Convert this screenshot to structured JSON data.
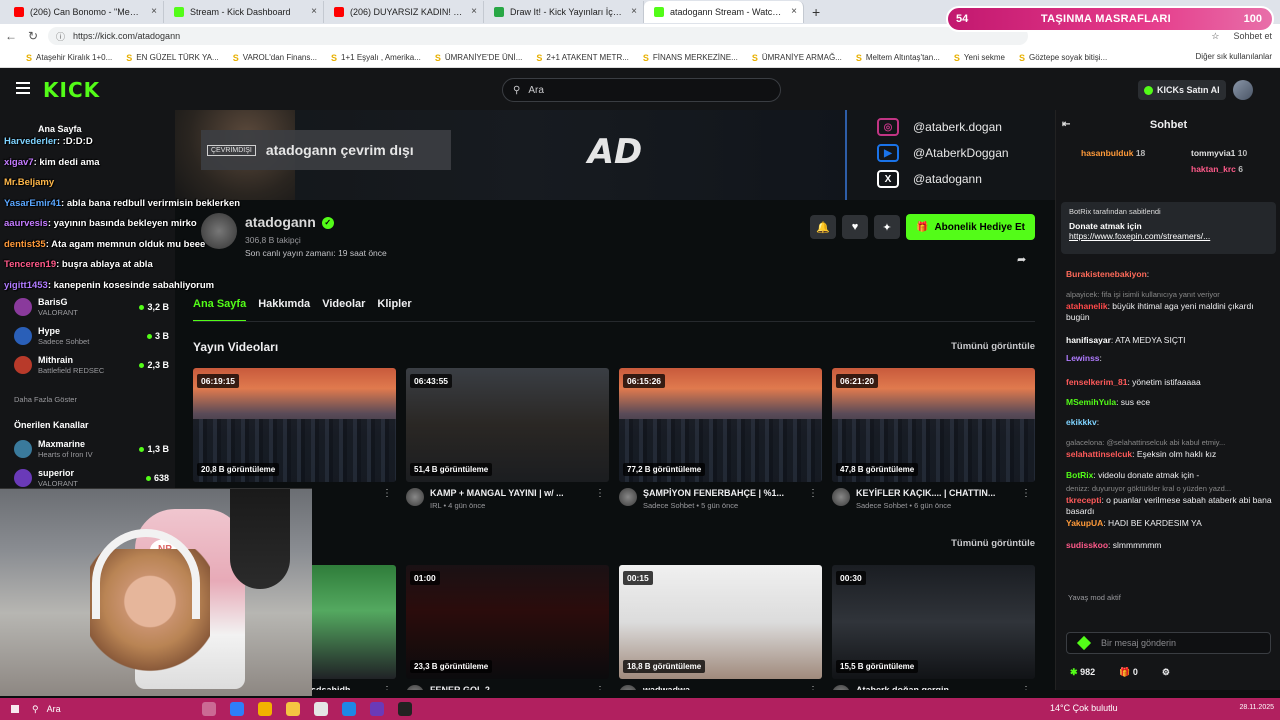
{
  "browser": {
    "tabs": [
      {
        "label": "(206) Can Bonomo - \"Mezcup\" - Y",
        "color": "#ff0000"
      },
      {
        "label": "Stream - Kick Dashboard",
        "color": "#53fc18"
      },
      {
        "label": "(206) DUYARSIZ KADIN! Türkiye'd",
        "color": "#ff0000"
      },
      {
        "label": "Draw It! - Kick Yayınları İçin Çizim",
        "color": "#28a745"
      },
      {
        "label": "atadogann Stream - Watch Live o",
        "color": "#53fc18"
      }
    ],
    "url": "https://kick.com/atadogann",
    "url_right": "Sohbet et",
    "bookmarks": [
      "Ataşehir Kiralık 1+0...",
      "EN GÜZEL TÜRK YA...",
      "VAROL'dan Finans...",
      "1+1 Eşyalı , Amerika...",
      "ÜMRANİYE'DE ÜNİ...",
      "2+1 ATAKENT METR...",
      "FİNANS MERKEZİNE...",
      "ÜMRANİYE ARMAĞ...",
      "Meltem Altıntaş'tan...",
      "Yeni sekme",
      "Göztepe soyak bitişi..."
    ],
    "bookmarks_right": "Diğer sık kullanılanlar"
  },
  "overlay_bar": {
    "left": "54",
    "title": "TAŞINMA MASRAFLARI",
    "right": "100"
  },
  "header": {
    "logo": "KICK",
    "search_placeholder": "Ara",
    "kicks_button": "KICKs Satın Al"
  },
  "sidebar": {
    "home": "Ana Sayfa",
    "channels": [
      {
        "name": "BarisG",
        "category": "VALORANT",
        "count": "3,2 B",
        "color": "#8a3a9c"
      },
      {
        "name": "Hype",
        "category": "Sadece Sohbet",
        "count": "3 B",
        "color": "#2a5fb8"
      },
      {
        "name": "Mithrain",
        "category": "Battlefield REDSEC",
        "count": "2,3 B",
        "color": "#b83a2a"
      }
    ],
    "show_more": "Daha Fazla Göster",
    "recommended_title": "Önerilen Kanallar",
    "recommended": [
      {
        "name": "Maxmarine",
        "category": "Hearts of Iron IV",
        "count": "1,3 B",
        "color": "#3a7a9c"
      },
      {
        "name": "superior",
        "category": "VALORANT",
        "count": "638",
        "color": "#6a3ab8"
      }
    ]
  },
  "overlay_chat": [
    {
      "user": "Harvederler",
      "text": ": :D:D:D",
      "color": "#7fd3ff"
    },
    {
      "user": "xigav7",
      "text": ": kim dedi ama",
      "color": "#c47bff"
    },
    {
      "user": "Mr.Beljamy",
      "text": "",
      "color": "#ffb84a"
    },
    {
      "user": "YasarEmir41",
      "text": ": abla bana redbull verirmisin beklerken",
      "color": "#5aa7ff"
    },
    {
      "user": "aaurvesis",
      "text": ": yayının basında bekleyen mirko",
      "color": "#c47bff"
    },
    {
      "user": "dentist35",
      "text": ": Ata agam memnun olduk mu beee",
      "color": "#ff9a3a"
    },
    {
      "user": "Tenceren19",
      "text": ": buşra ablaya at abla",
      "color": "#ff5a8a"
    },
    {
      "user": "yigitt1453",
      "text": ": kanepenin kosesinde sabahliyorum",
      "color": "#b07bff"
    }
  ],
  "channel": {
    "offline_tag": "ÇEVRİMDIŞI",
    "offline_text": "atadogann çevrim dışı",
    "banner_logo": "AD",
    "name": "atadogann",
    "followers": "306,8 B takipçi",
    "last_stream": "Son canlı yayın zamanı: 19 saat önce",
    "subscribe_label": "Abonelik Hediye Et",
    "socials": [
      {
        "handle": "@ataberk.dogan",
        "icon": "instagram-icon",
        "color": "#c13584"
      },
      {
        "handle": "@AtaberkDoggan",
        "icon": "youtube-icon",
        "color": "#1a73e8"
      },
      {
        "handle": "@atadogann",
        "icon": "x-twitter-icon",
        "color": "#ffffff"
      }
    ],
    "tabs": [
      "Ana Sayfa",
      "Hakkımda",
      "Videolar",
      "Klipler"
    ]
  },
  "sections": {
    "videos_title": "Yayın Videoları",
    "see_all": "Tümünü görüntüle",
    "see_all_2": "Tümünü görüntüle"
  },
  "videos": [
    {
      "duration": "06:19:15",
      "views": "20,8 B görüntüleme",
      "title": "NCVAROS ...",
      "meta": "önce",
      "style": "city"
    },
    {
      "duration": "06:43:55",
      "views": "51,4 B görüntüleme",
      "title": "KAMP + MANGAL YAYINI | w/ ...",
      "meta": "IRL • 4 gün önce",
      "style": "people"
    },
    {
      "duration": "06:15:26",
      "views": "77,2 B görüntüleme",
      "title": "ŞAMPİYON FENERBAHÇE | %1...",
      "meta": "Sadece Sohbet • 5 gün önce",
      "style": "city"
    },
    {
      "duration": "06:21:20",
      "views": "47,8 B görüntüleme",
      "title": "KEYİFLER KAÇIK.... | CHATTIN...",
      "meta": "Sadece Sohbet • 6 gün önce",
      "style": "city"
    }
  ],
  "clips": [
    {
      "duration": "",
      "views": "",
      "title": "banlayın çocuklarrrr asdsahidh",
      "style": "green"
    },
    {
      "duration": "01:00",
      "views": "23,3 B görüntüleme",
      "title": "FENER GOL 2",
      "style": "dark"
    },
    {
      "duration": "00:15",
      "views": "18,8 B görüntüleme",
      "title": "wadwadwa",
      "style": "bright"
    },
    {
      "duration": "00:30",
      "views": "15,5 B görüntüleme",
      "title": "Ataberk doğan gergin",
      "style": "stage"
    }
  ],
  "chat": {
    "title": "Sohbet",
    "gifters": [
      {
        "name": "hasanbulduk",
        "count": "18",
        "color": "#ff9a3a"
      },
      {
        "name": "tommyvia1",
        "count": "10",
        "color": "#e0e0e0"
      },
      {
        "name": "haktan_krc",
        "count": "6",
        "color": "#ff5a8a"
      }
    ],
    "pinned_by": "BotRix tarafından sabitlendi",
    "pinned_msg": "Donate atmak için",
    "pinned_link": "https://www.foxepin.com/streamers/...",
    "lines": [
      {
        "user": "Burakistenebakiyon",
        "text": ":",
        "color": "#ff6a5a",
        "sys": false
      },
      {
        "user": "",
        "text": "alpayicek: fifa işi isimli kullanıcıya yanıt veriyor",
        "color": "#888",
        "sys": true
      },
      {
        "user": "atahanelik",
        "text": ": büyük ihtimal aga yeni maldini çıkardı bugün",
        "color": "#ff4a4a",
        "sys": false
      },
      {
        "user": "hanifisayar",
        "text": ": ATA MEDYA SIÇTI",
        "color": "#ffffff",
        "sys": false
      },
      {
        "user": "Lewinss",
        "text": ":",
        "color": "#b07bff",
        "sys": false
      },
      {
        "user": "fenselkerim_81",
        "text": ": yönetim istifaaaaa",
        "color": "#ff5a5a",
        "sys": false
      },
      {
        "user": "MSemihYula",
        "text": ": sus ece",
        "color": "#53fc18",
        "sys": false
      },
      {
        "user": "ekikkkv",
        "text": ":",
        "color": "#7fd3ff",
        "sys": false
      },
      {
        "user": "",
        "text": "galacelona: @selahattinselcuk abi kabul etmiy...",
        "color": "#888",
        "sys": true
      },
      {
        "user": "selahattinselcuk",
        "text": ": Eşeksin olm haklı kız",
        "color": "#ff5a5a",
        "sys": false
      },
      {
        "user": "BotRix",
        "text": ": videolu donate atmak için -",
        "color": "#53fc18",
        "sys": false
      },
      {
        "user": "",
        "text": "denizz: duyuruyor göktürkler kral o yüzden yazd...",
        "color": "#888",
        "sys": true
      },
      {
        "user": "tkrecepti",
        "text": ": o puanlar verilmese sabah ataberk abi bana basardı",
        "color": "#ff5a5a",
        "sys": false
      },
      {
        "user": "YakupUA",
        "text": ": HADI BE KARDESIM YA",
        "color": "#ff9a3a",
        "sys": false
      },
      {
        "user": "sudisskoo",
        "text": ": slmmmmmm",
        "color": "#ff5a8a",
        "sys": false
      }
    ],
    "slow_mode": "Yavaş mod aktif",
    "input_placeholder": "Bir mesaj gönderin",
    "points": "982",
    "gift_count": "0"
  },
  "taskbar": {
    "search": "Ara",
    "weather": "14°C  Çok bulutlu",
    "date": "28.11.2025"
  }
}
